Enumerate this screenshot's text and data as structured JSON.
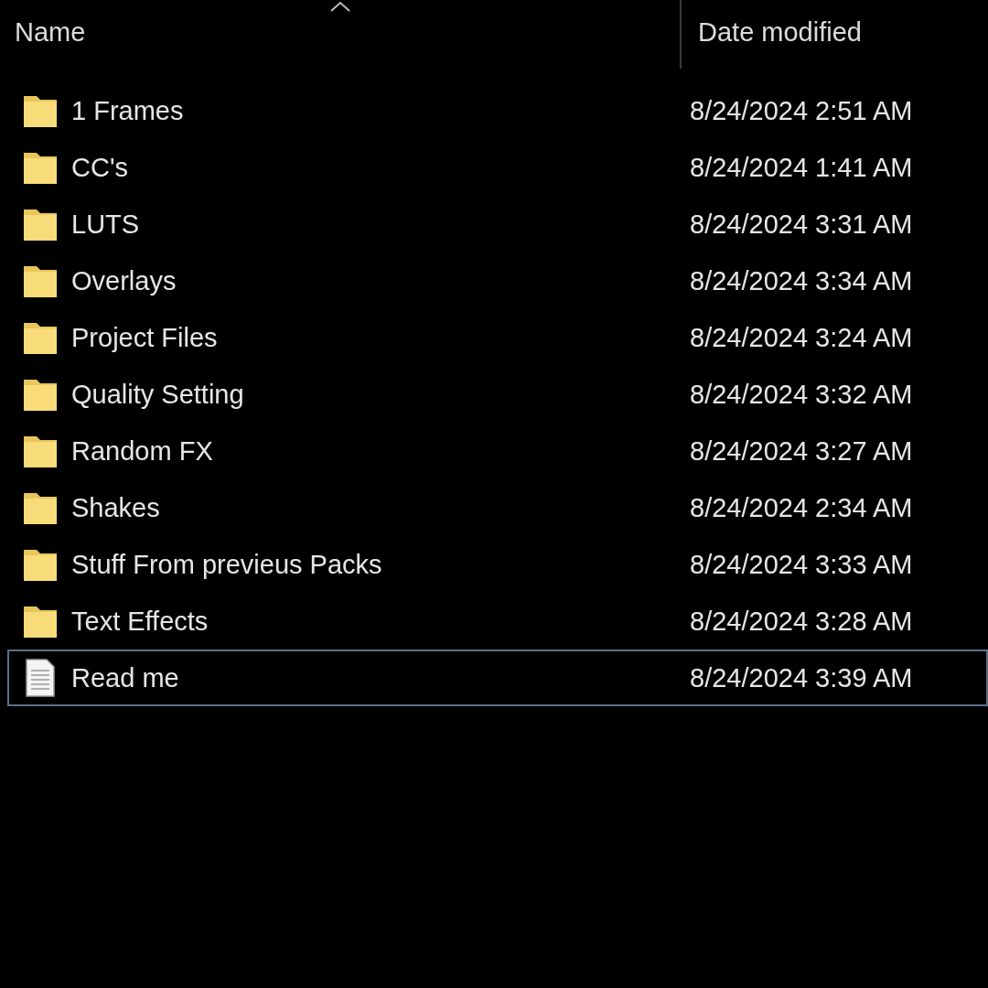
{
  "columns": [
    {
      "label": "Name",
      "sorted": true
    },
    {
      "label": "Date modified",
      "sorted": false
    }
  ],
  "rows": [
    {
      "name": "1 Frames",
      "date": "8/24/2024 2:51 AM",
      "kind": "folder",
      "focused": false
    },
    {
      "name": "CC's",
      "date": "8/24/2024 1:41 AM",
      "kind": "folder",
      "focused": false
    },
    {
      "name": "LUTS",
      "date": "8/24/2024 3:31 AM",
      "kind": "folder",
      "focused": false
    },
    {
      "name": "Overlays",
      "date": "8/24/2024 3:34 AM",
      "kind": "folder",
      "focused": false
    },
    {
      "name": "Project Files",
      "date": "8/24/2024 3:24 AM",
      "kind": "folder",
      "focused": false
    },
    {
      "name": "Quality Setting",
      "date": "8/24/2024 3:32 AM",
      "kind": "folder",
      "focused": false
    },
    {
      "name": "Random FX",
      "date": "8/24/2024 3:27 AM",
      "kind": "folder",
      "focused": false
    },
    {
      "name": "Shakes",
      "date": "8/24/2024 2:34 AM",
      "kind": "folder",
      "focused": false
    },
    {
      "name": "Stuff From previeus Packs",
      "date": "8/24/2024 3:33 AM",
      "kind": "folder",
      "focused": false
    },
    {
      "name": "Text Effects",
      "date": "8/24/2024 3:28 AM",
      "kind": "folder",
      "focused": false
    },
    {
      "name": "Read me",
      "date": "8/24/2024 3:39 AM",
      "kind": "file",
      "focused": true
    }
  ]
}
